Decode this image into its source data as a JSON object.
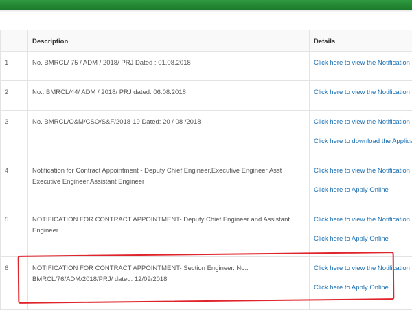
{
  "header": {
    "accent_color": "#249038"
  },
  "table": {
    "columns": {
      "no": "",
      "description": "Description",
      "details": "Details"
    },
    "rows": [
      {
        "no": "1",
        "description": "No. BMRCL/ 75 / ADM / 2018/ PRJ Dated : 01.08.2018",
        "links": [
          "Click here to view the Notification"
        ]
      },
      {
        "no": "2",
        "description": "No.. BMRCL/44/ ADM / 2018/ PRJ dated: 06.08.2018",
        "links": [
          "Click here to view the Notification"
        ]
      },
      {
        "no": "3",
        "description": "No. BMRCL/O&M/CSO/S&F/2018-19 Dated: 20 / 08 /2018",
        "links": [
          "Click here to view the Notification",
          "Click here to download the Application form"
        ]
      },
      {
        "no": "4",
        "description": "Notification for Contract Appointment - Deputy Chief Engineer,Executive Engineer,Asst Executive Engineer,Assistant Engineer",
        "links": [
          "Click here to view the Notification",
          "Click here to Apply Online"
        ]
      },
      {
        "no": "5",
        "description": "NOTIFICATION FOR CONTRACT APPOINTMENT- Deputy Chief Engineer and Assistant Engineer",
        "links": [
          "Click here to view the Notification",
          "Click here to Apply Online"
        ]
      },
      {
        "no": "6",
        "description": "NOTIFICATION FOR CONTRACT APPOINTMENT- Section Engineer. No.: BMRCL/76/ADM/2018/PRJ/ dated: 12/09/2018",
        "links": [
          "Click here to view the Notification",
          "Click here to Apply Online"
        ]
      }
    ]
  },
  "annotation": {
    "highlight_color": "#e0242b",
    "highlighted_row": "6"
  }
}
